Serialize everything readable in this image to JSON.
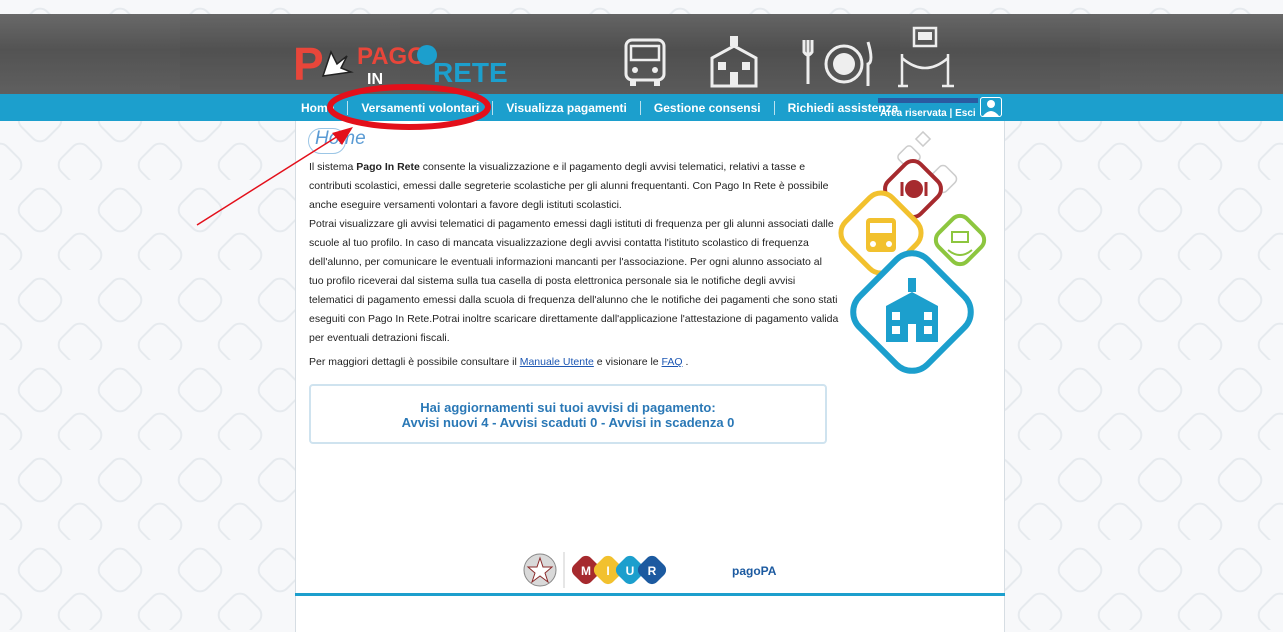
{
  "header": {
    "logo": {
      "line1": "PAGO",
      "line2": "IN",
      "line3": "RETE"
    }
  },
  "nav": {
    "items": [
      {
        "label": "Home"
      },
      {
        "label": "Versamenti volontari"
      },
      {
        "label": "Visualizza pagamenti"
      },
      {
        "label": "Gestione consensi"
      },
      {
        "label": "Richiedi assistenza"
      }
    ],
    "area": "Area riservata",
    "separator": "|",
    "esci": "Esci"
  },
  "page": {
    "title": "Home",
    "p1_a": "Il sistema ",
    "p1_b": "Pago In Rete",
    "p1_c": " consente la visualizzazione e il pagamento degli avvisi telematici, relativi a tasse e contributi scolastici, emessi dalle segreterie scolastiche per gli alunni frequentanti. Con Pago In Rete è possibile anche eseguire versamenti volontari a favore degli istituti scolastici.",
    "p2": "Potrai visualizzare gli avvisi telematici di pagamento emessi dagli istituti di frequenza per gli alunni associati dalle scuole al tuo profilo. In caso di mancata visualizzazione degli avvisi contatta l'istituto scolastico di frequenza dell'alunno, per comunicare le eventuali informazioni mancanti per l'associazione. Per ogni alunno associato al tuo profilo riceverai dal sistema sulla tua casella di posta elettronica personale sia le notifiche degli avvisi telematici di pagamento emessi dalla scuola di frequenza dell'alunno che le notifiche dei pagamenti che sono stati eseguiti con Pago In Rete.Potrai inoltre scaricare direttamente dall'applicazione l'attestazione di pagamento valida per eventuali detrazioni fiscali.",
    "p3_a": "Per maggiori dettagli è possibile consultare il ",
    "p3_link1": "Manuale Utente",
    "p3_b": " e visionare le ",
    "p3_link2": "FAQ",
    "p3_c": " ."
  },
  "notice": {
    "line1": "Hai aggiornamenti sui tuoi avvisi di pagamento:",
    "line2": "Avvisi nuovi 4 - Avvisi scaduti 0 - Avvisi in scadenza 0"
  },
  "footer": {
    "miur_letters": [
      "M",
      "I",
      "U",
      "R"
    ],
    "pagopa": "pagoPA"
  },
  "colors": {
    "nav": "#1c9fcd",
    "annotation": "#e3101b",
    "notice_text": "#2a78b6"
  },
  "icons": [
    "bus-icon",
    "school-icon",
    "meal-icon",
    "museum-icon",
    "user-icon"
  ]
}
